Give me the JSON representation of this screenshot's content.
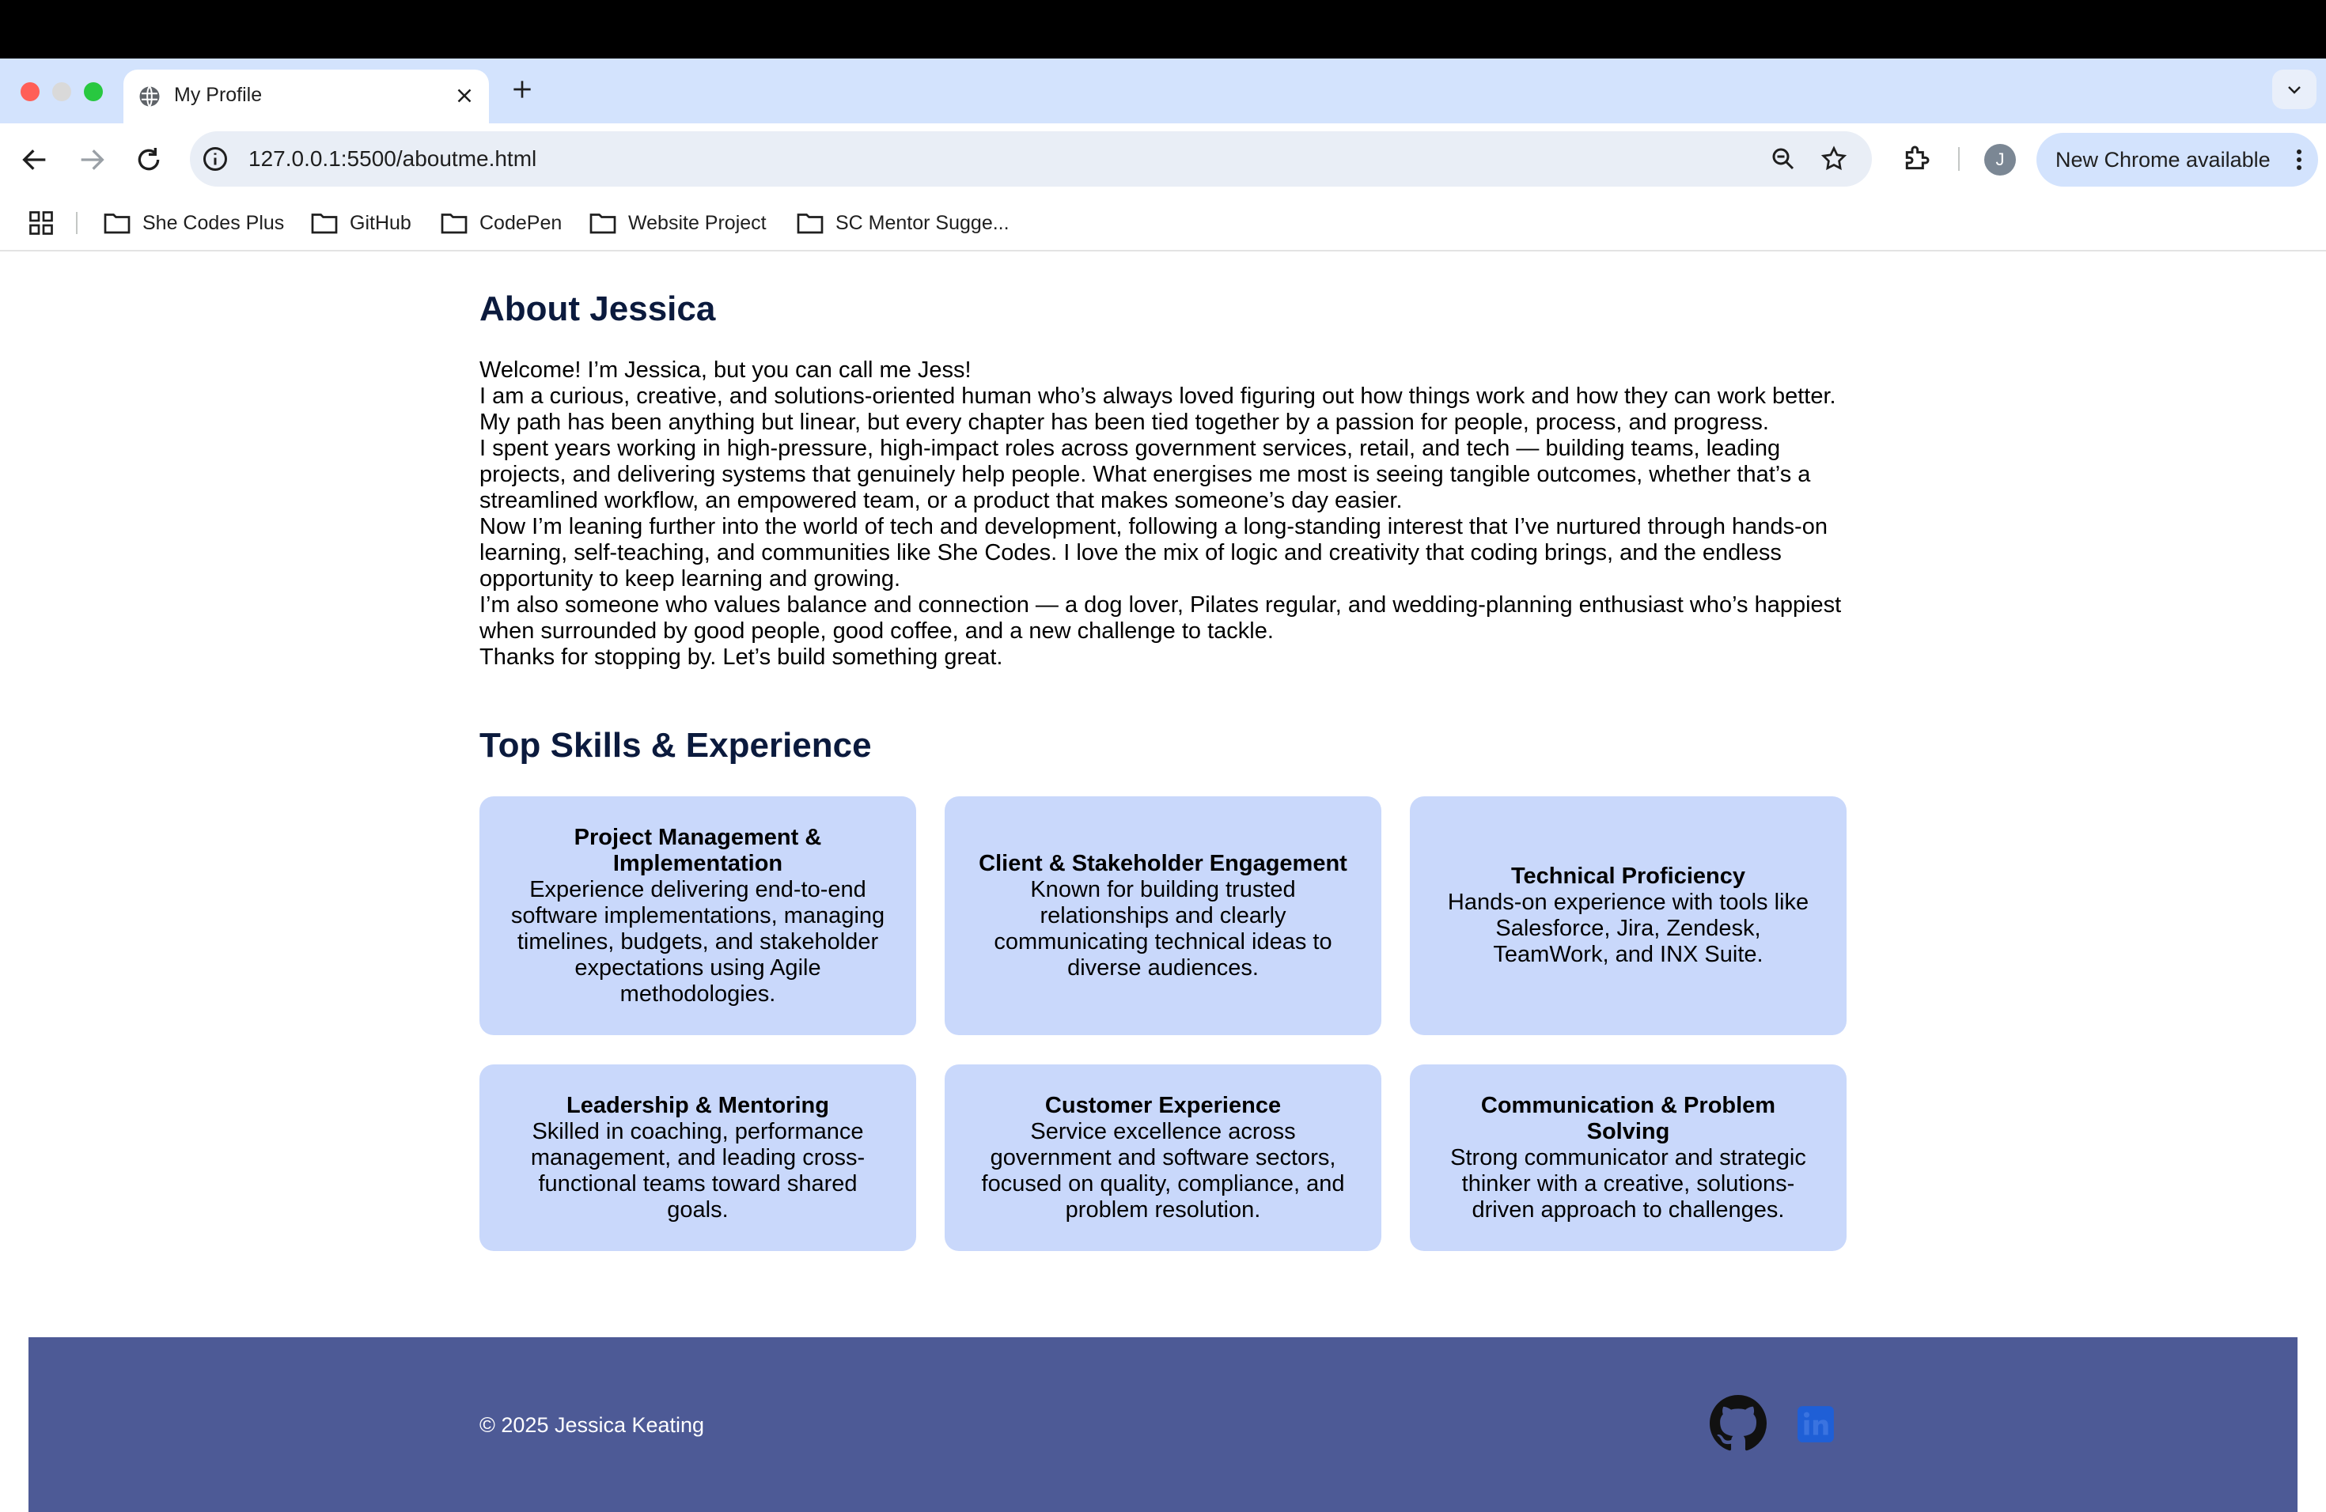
{
  "browser": {
    "tab": {
      "title": "My Profile",
      "favicon": "globe-icon"
    },
    "address": "127.0.0.1:5500/aboutme.html",
    "profile_initial": "J",
    "update_label": "New Chrome available",
    "bookmarks": [
      "She Codes Plus",
      "GitHub",
      "CodePen",
      "Website Project",
      "SC Mentor Sugge..."
    ]
  },
  "about": {
    "heading": "About Jessica",
    "paragraphs": [
      "Welcome! I’m Jessica, but you can call me Jess!",
      "I am a curious, creative, and solutions-oriented human who’s always loved figuring out how things work and how they can work better. My path has been anything but linear, but every chapter has been tied together by a passion for people, process, and progress.",
      "I spent years working in high-pressure, high-impact roles across government services, retail, and tech — building teams, leading projects, and delivering systems that genuinely help people. What energises me most is seeing tangible outcomes, whether that’s a streamlined workflow, an empowered team, or a product that makes someone’s day easier.",
      "Now I’m leaning further into the world of tech and development, following a long-standing interest that I’ve nurtured through hands-on learning, self-teaching, and communities like She Codes. I love the mix of logic and creativity that coding brings, and the endless opportunity to keep learning and growing.",
      "I’m also someone who values balance and connection — a dog lover, Pilates regular, and wedding-planning enthusiast who’s happiest when surrounded by good people, good coffee, and a new challenge to tackle.",
      "Thanks for stopping by. Let’s build something great."
    ]
  },
  "skills": {
    "heading": "Top Skills & Experience",
    "cards": [
      {
        "title": "Project Management & Implementation",
        "description": "Experience delivering end-to-end software implementations, managing timelines, budgets, and stakeholder expectations using Agile methodologies."
      },
      {
        "title": "Client & Stakeholder Engagement",
        "description": "Known for building trusted relationships and clearly communicating technical ideas to diverse audiences."
      },
      {
        "title": "Technical Proficiency",
        "description": "Hands-on experience with tools like Salesforce, Jira, Zendesk, TeamWork, and INX Suite."
      },
      {
        "title": "Leadership & Mentoring",
        "description": "Skilled in coaching, performance management, and leading cross-functional teams toward shared goals."
      },
      {
        "title": "Customer Experience",
        "description": "Service excellence across government and software sectors, focused on quality, compliance, and problem resolution."
      },
      {
        "title": "Communication & Problem Solving",
        "description": "Strong communicator and strategic thinker with a creative, solutions-driven approach to challenges."
      }
    ]
  },
  "footer": {
    "copyright": "© 2025 Jessica Keating",
    "social_icons": [
      "github-icon",
      "linkedin-icon"
    ]
  },
  "colors": {
    "heading": "#0b1a3d",
    "card_bg": "#c9d8fb",
    "footer_bg": "#4d5a96",
    "linkedin_blue": "#1f5fd6"
  }
}
